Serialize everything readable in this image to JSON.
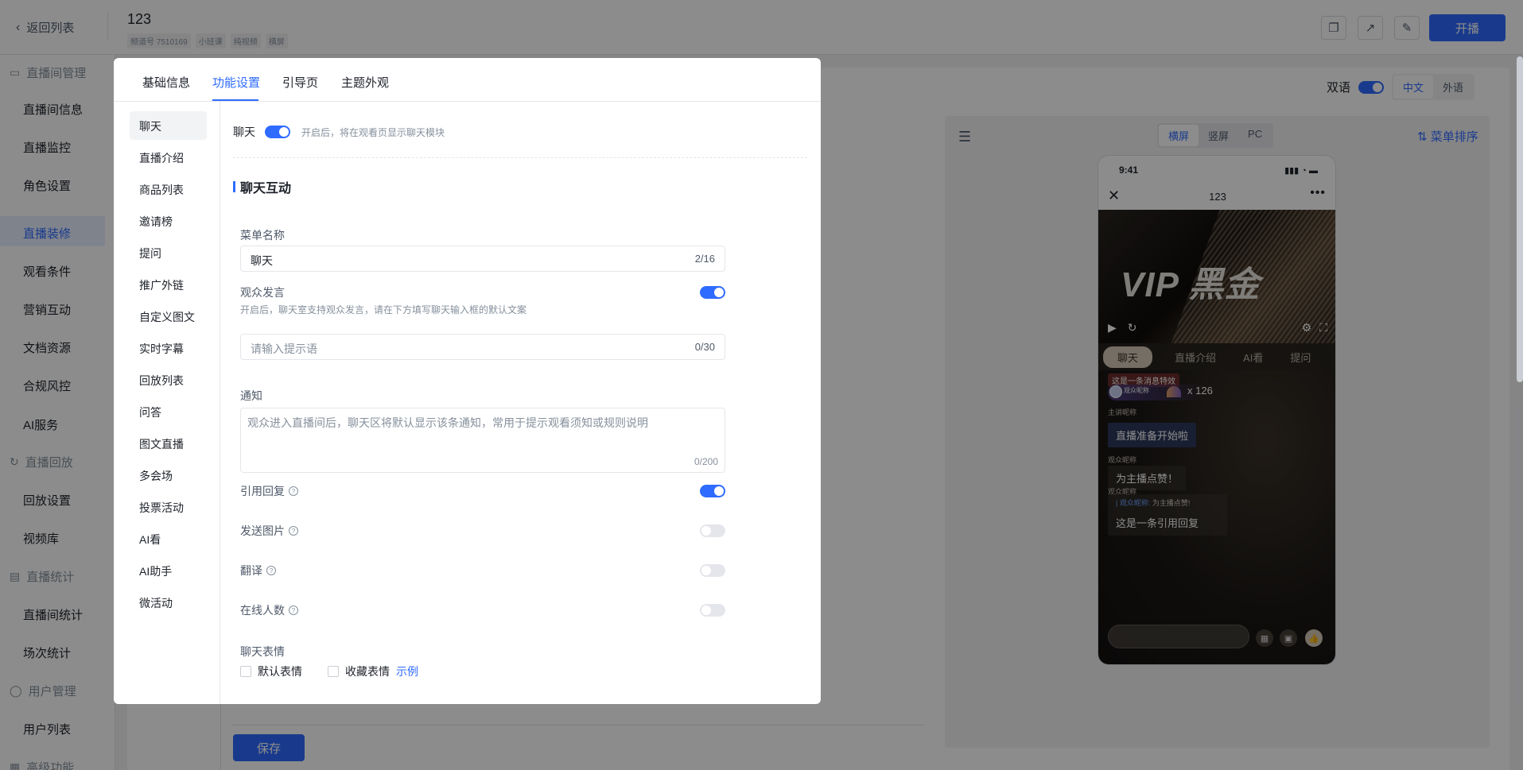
{
  "header": {
    "back_label": "返回列表",
    "title": "123",
    "tags": [
      "频道号 7510169",
      "小班课",
      "纯视频",
      "横屏"
    ],
    "start_label": "开播"
  },
  "leftnav": {
    "groups": [
      {
        "label": "直播间管理",
        "icon": "monitor-icon"
      },
      {
        "label": "直播回放",
        "icon": "replay-icon"
      },
      {
        "label": "直播统计",
        "icon": "stats-icon"
      },
      {
        "label": "用户管理",
        "icon": "user-icon"
      },
      {
        "label": "高级功能",
        "icon": "advanced-icon"
      }
    ],
    "items": [
      "直播间信息",
      "直播监控",
      "角色设置",
      "直播装修",
      "观看条件",
      "营销互动",
      "文档资源",
      "合规风控",
      "AI服务",
      "回放设置",
      "视频库",
      "直播间统计",
      "场次统计",
      "用户列表"
    ],
    "active_item": "直播装修"
  },
  "background": {
    "bilingual_label": "双语",
    "lang_options": [
      "中文",
      "外语"
    ],
    "lang_selected": "中文",
    "orientation_options": [
      "横屏",
      "竖屏",
      "PC"
    ],
    "orientation_selected": "横屏",
    "sort_label": "菜单排序",
    "save_label": "保存"
  },
  "phone": {
    "time": "9:41",
    "title": "123",
    "video_text": "VIP 黑金",
    "tabs": [
      "聊天",
      "直播介绍",
      "AI看",
      "提问"
    ],
    "active_tab": "聊天",
    "effect_label": "这是一条消息特效",
    "gift_name": "观众昵称",
    "gift_count": "x 126",
    "host_label": "主讲昵称",
    "host_message": "直播准备开始啦",
    "viewer_label_1": "观众昵称",
    "viewer_message_1": "为主播点赞！",
    "viewer_label_2": "观众昵称",
    "quote_name": "| 观众昵称:",
    "quote_text": "为主播点赞!",
    "quote_reply": "这是一条引用回复"
  },
  "modal": {
    "tabs": [
      "基础信息",
      "功能设置",
      "引导页",
      "主题外观"
    ],
    "active_tab": "功能设置",
    "side_items": [
      "聊天",
      "直播介绍",
      "商品列表",
      "邀请榜",
      "提问",
      "推广外链",
      "自定义图文",
      "实时字幕",
      "回放列表",
      "问答",
      "图文直播",
      "多会场",
      "投票活动",
      "AI看",
      "AI助手",
      "微活动"
    ],
    "active_side_item": "聊天",
    "chat_toggle": {
      "label": "聊天",
      "on": true,
      "hint": "开启后，将在观看页显示聊天模块"
    },
    "section_title": "聊天互动",
    "menu_name": {
      "label": "菜单名称",
      "value": "聊天",
      "count": "2/16"
    },
    "audience_speech": {
      "label": "观众发言",
      "on": true,
      "desc": "开启后，聊天室支持观众发言，请在下方填写聊天输入框的默认文案"
    },
    "prompt_input": {
      "placeholder": "请输入提示语",
      "count": "0/30"
    },
    "notice": {
      "label": "通知",
      "placeholder": "观众进入直播间后，聊天区将默认显示该条通知，常用于提示观看须知或规则说明",
      "count": "0/200"
    },
    "toggles": [
      {
        "label": "引用回复",
        "on": true
      },
      {
        "label": "发送图片",
        "on": false
      },
      {
        "label": "翻译",
        "on": false
      },
      {
        "label": "在线人数",
        "on": false
      }
    ],
    "emoji": {
      "label": "聊天表情",
      "options": [
        "默认表情",
        "收藏表情"
      ],
      "example_link": "示例"
    }
  }
}
